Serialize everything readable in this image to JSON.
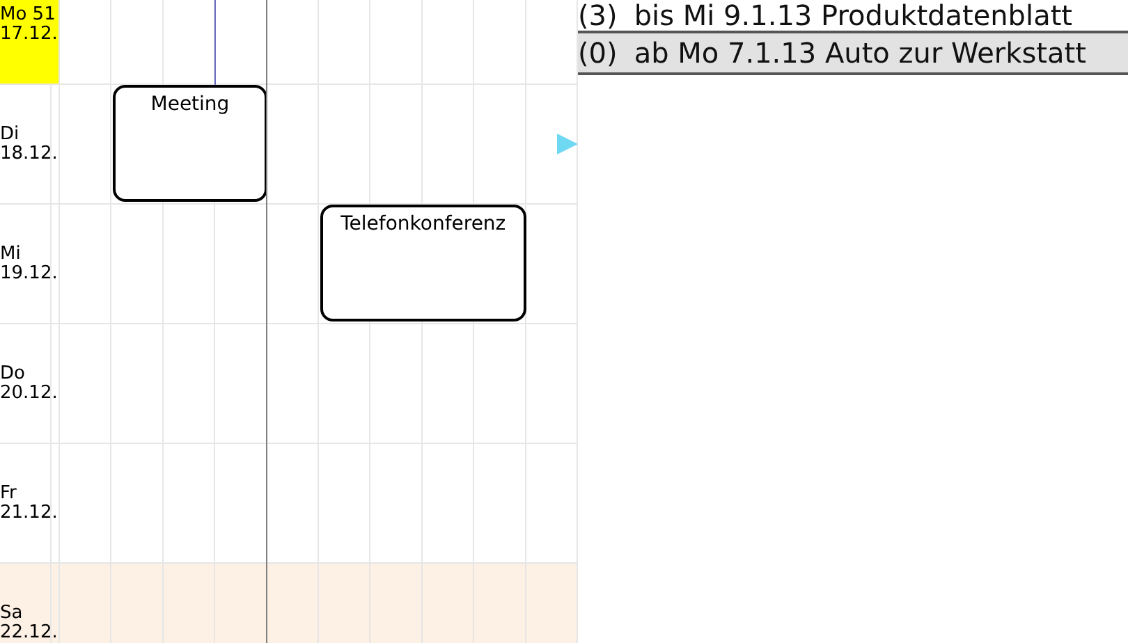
{
  "calendar": {
    "days": [
      {
        "weekday": "Mo 51",
        "date": "17.12.",
        "kind": "today"
      },
      {
        "weekday": "Di",
        "date": "18.12.",
        "kind": "weekday",
        "events": [
          {
            "title": "Meeting"
          }
        ]
      },
      {
        "weekday": "Mi",
        "date": "19.12.",
        "kind": "weekday",
        "events": [
          {
            "title": "Telefonkonferenz"
          }
        ]
      },
      {
        "weekday": "Do",
        "date": "20.12.",
        "kind": "weekday"
      },
      {
        "weekday": "Fr",
        "date": "21.12.",
        "kind": "weekday"
      },
      {
        "weekday": "Sa",
        "date": "22.12.",
        "kind": "weekend"
      }
    ]
  },
  "tasks": [
    {
      "count": "(3)",
      "text": "bis Mi 9.1.13 Produktdatenblatt",
      "selected": false
    },
    {
      "count": "(0)",
      "text": "ab Mo 7.1.13 Auto zur Werkstatt",
      "selected": true
    }
  ]
}
